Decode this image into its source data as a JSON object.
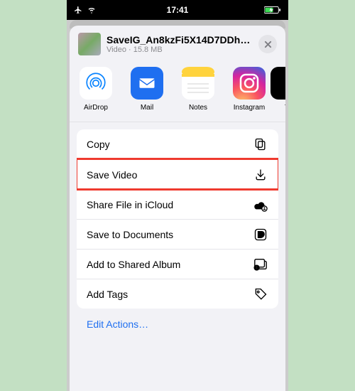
{
  "status": {
    "clock": "17:41"
  },
  "file": {
    "name": "SaveIG_An8kzFi5X14D7DDhXM...",
    "type_label": "Video",
    "size_label": "15.8 MB"
  },
  "share_targets": [
    {
      "id": "airdrop",
      "label": "AirDrop"
    },
    {
      "id": "mail",
      "label": "Mail"
    },
    {
      "id": "notes",
      "label": "Notes"
    },
    {
      "id": "instagram",
      "label": "Instagram"
    }
  ],
  "actions": {
    "copy": "Copy",
    "save_video": "Save Video",
    "share_icloud": "Share File in iCloud",
    "save_docs": "Save to Documents",
    "shared_album": "Add to Shared Album",
    "add_tags": "Add Tags"
  },
  "edit_actions_label": "Edit Actions…"
}
